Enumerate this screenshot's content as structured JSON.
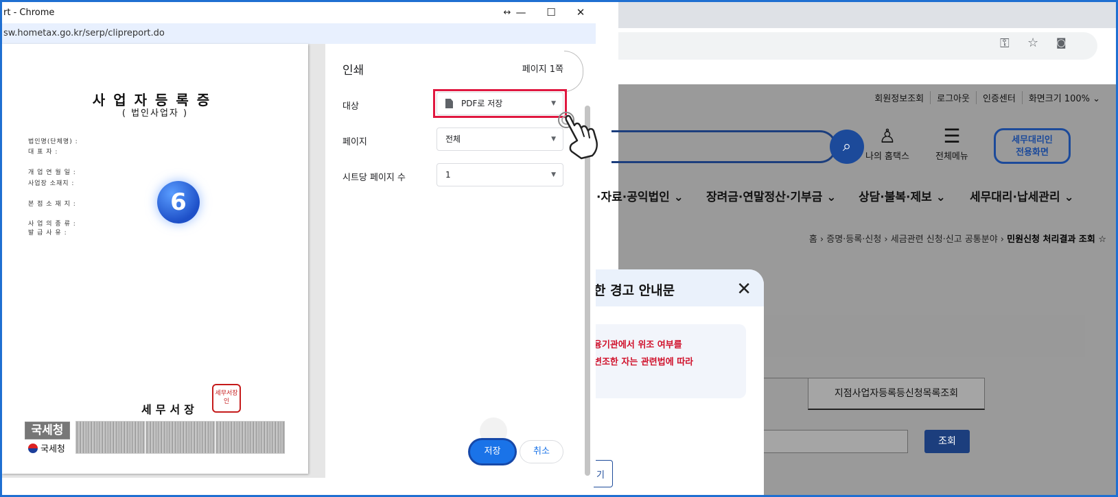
{
  "popup": {
    "title": "rt - Chrome",
    "address": "sw.hometax.go.kr/serp/clipreport.do",
    "controls": {
      "move": "↔",
      "minimize": "—",
      "maximize": "☐",
      "close": "✕"
    }
  },
  "document": {
    "title": "사업자등록증",
    "subtitle": "( 법인사업자 )",
    "fields": {
      "corp_name": "법인명(단체명) :",
      "representative": "대 표 자 :",
      "open_date": "개 업 연 월 일 :",
      "location": "사업장 소재지 :",
      "hq_location": "본 점 소 재 지 :",
      "business_type": "사 업 의 종 류 :",
      "issue_reason": "발 급 사 유 :"
    },
    "step_badge": "6",
    "chief": "세무서장",
    "seal_text": "세무서장인",
    "nts_box": "국세청",
    "nts_logo": "국세청"
  },
  "print_settings": {
    "heading": "인쇄",
    "page_count": "페이지 1쪽",
    "destination_label": "대상",
    "destination_value": "PDF로 저장",
    "pages_label": "페이지",
    "pages_value": "전체",
    "per_sheet_label": "시트당 페이지 수",
    "per_sheet_value": "1",
    "save_button": "저장",
    "cancel_button": "취소"
  },
  "background_site": {
    "util_links": [
      "회원정보조회",
      "로그아웃",
      "인증센터",
      "화면크기 100% ⌄"
    ],
    "my_hometax": "나의 홈택스",
    "all_menu": "전체메뉴",
    "agent_line1": "세무대리인",
    "agent_line2": "전용화면",
    "gnb": [
      "·자료·공익법인 ⌄",
      "장려금·연말정산·기부금 ⌄",
      "상담·불복·제보 ⌄",
      "세무대리·납세관리 ⌄"
    ],
    "breadcrumb": "홈 › 증명·등록·신청 › 세금관련 신청·신고 공통분야 ›",
    "breadcrumb_current": "민원신청 처리결과 조회 ☆",
    "tab_label": "지점사업자등록등신청목록조회",
    "lookup_button": "조회"
  },
  "modal": {
    "title": "한 경고 안내문",
    "close": "✕",
    "warn_line1": "융기관에서 위조 여부를",
    "warn_line2": "변조한 자는 관련법에 따라",
    "foot_button": "기"
  },
  "colors": {
    "accent": "#1a73e8",
    "highlight": "#e0173f",
    "navy": "#1c3e7d",
    "frame": "#1f6fd1"
  }
}
